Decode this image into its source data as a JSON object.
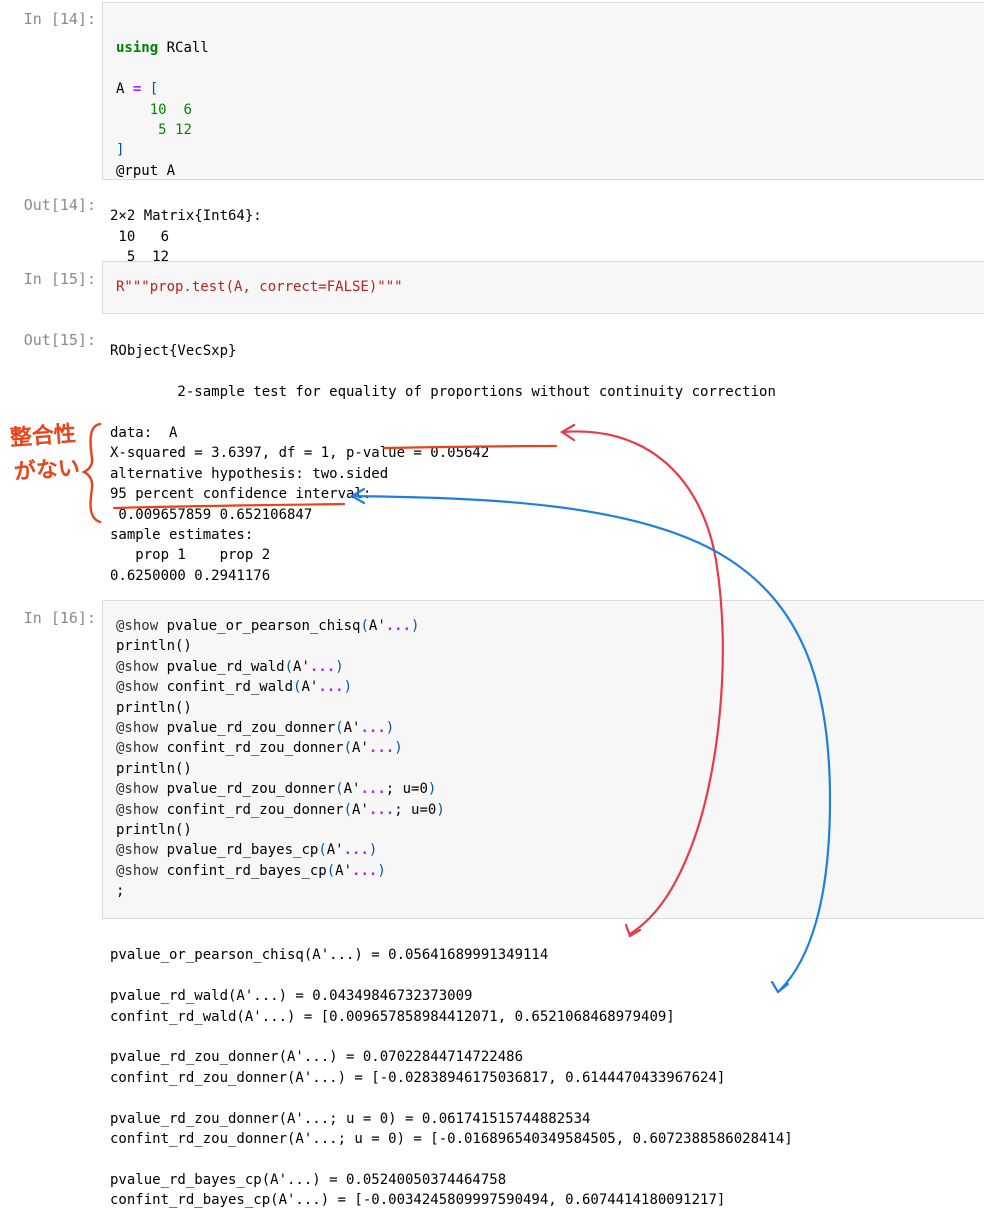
{
  "cells": {
    "c14": {
      "in_prompt": "In [14]:",
      "out_prompt": "Out[14]:",
      "code": {
        "kw": "using",
        "mod": " RCall",
        "a_open_lhs": "A ",
        "a_open_eq": "=",
        "a_open_br": " [",
        "row1_a": "10",
        "row1_b": "6",
        "row2_a": "5",
        "row2_b": "12",
        "close": "]",
        "rput": "@rput A"
      },
      "output": [
        "2×2 Matrix{Int64}:",
        " 10   6",
        "  5  12"
      ]
    },
    "c15": {
      "in_prompt": "In [15]:",
      "out_prompt": "Out[15]:",
      "code": "R\"\"\"prop.test(A, correct=FALSE)\"\"\"",
      "output": [
        "RObject{VecSxp}",
        "",
        "        2-sample test for equality of proportions without continuity correction",
        "",
        "data:  A",
        "X-squared = 3.6397, df = 1, p-value = 0.05642",
        "alternative hypothesis: two.sided",
        "95 percent confidence interval:",
        " 0.009657859 0.652106847",
        "sample estimates:",
        "   prop 1    prop 2 ",
        "0.6250000 0.2941176 "
      ]
    },
    "c16": {
      "in_prompt": "In [16]:",
      "code": [
        {
          "m": "@show",
          "f": " pvalue_or_pearson_chisq",
          "a": "A'",
          "d": "...",
          "e": ""
        },
        {
          "plain": "println()"
        },
        {
          "m": "@show",
          "f": " pvalue_rd_wald",
          "a": "A'",
          "d": "...",
          "e": ""
        },
        {
          "m": "@show",
          "f": " confint_rd_wald",
          "a": "A'",
          "d": "...",
          "e": ""
        },
        {
          "plain": "println()"
        },
        {
          "m": "@show",
          "f": " pvalue_rd_zou_donner",
          "a": "A'",
          "d": "...",
          "e": ""
        },
        {
          "m": "@show",
          "f": " confint_rd_zou_donner",
          "a": "A'",
          "d": "...",
          "e": ""
        },
        {
          "plain": "println()"
        },
        {
          "m": "@show",
          "f": " pvalue_rd_zou_donner",
          "a": "A'",
          "d": "...",
          "e": "; u=0"
        },
        {
          "m": "@show",
          "f": " confint_rd_zou_donner",
          "a": "A'",
          "d": "...",
          "e": "; u=0"
        },
        {
          "plain": "println()"
        },
        {
          "m": "@show",
          "f": " pvalue_rd_bayes_cp",
          "a": "A'",
          "d": "...",
          "e": ""
        },
        {
          "m": "@show",
          "f": " confint_rd_bayes_cp",
          "a": "A'",
          "d": "...",
          "e": ""
        },
        {
          "plain": ";"
        }
      ],
      "output": [
        "pvalue_or_pearson_chisq(A'...) = 0.05641689991349114",
        "",
        "pvalue_rd_wald(A'...) = 0.04349846732373009",
        "confint_rd_wald(A'...) = [0.009657858984412071, 0.6521068468979409]",
        "",
        "pvalue_rd_zou_donner(A'...) = 0.07022844714722486",
        "confint_rd_zou_donner(A'...) = [-0.02838946175036817, 0.6144470433967624]",
        "",
        "pvalue_rd_zou_donner(A'...; u = 0) = 0.061741515744882534",
        "confint_rd_zou_donner(A'...; u = 0) = [-0.016896540349584505, 0.6072388586028414]",
        "",
        "pvalue_rd_bayes_cp(A'...) = 0.05240050374464758",
        "confint_rd_bayes_cp(A'...) = [-0.0034245809997590494, 0.6074414180091217]"
      ]
    }
  },
  "annotation": {
    "line1": "整合性",
    "line2": "がない",
    "red": "#e8431b",
    "blue": "#1f7fe0"
  }
}
